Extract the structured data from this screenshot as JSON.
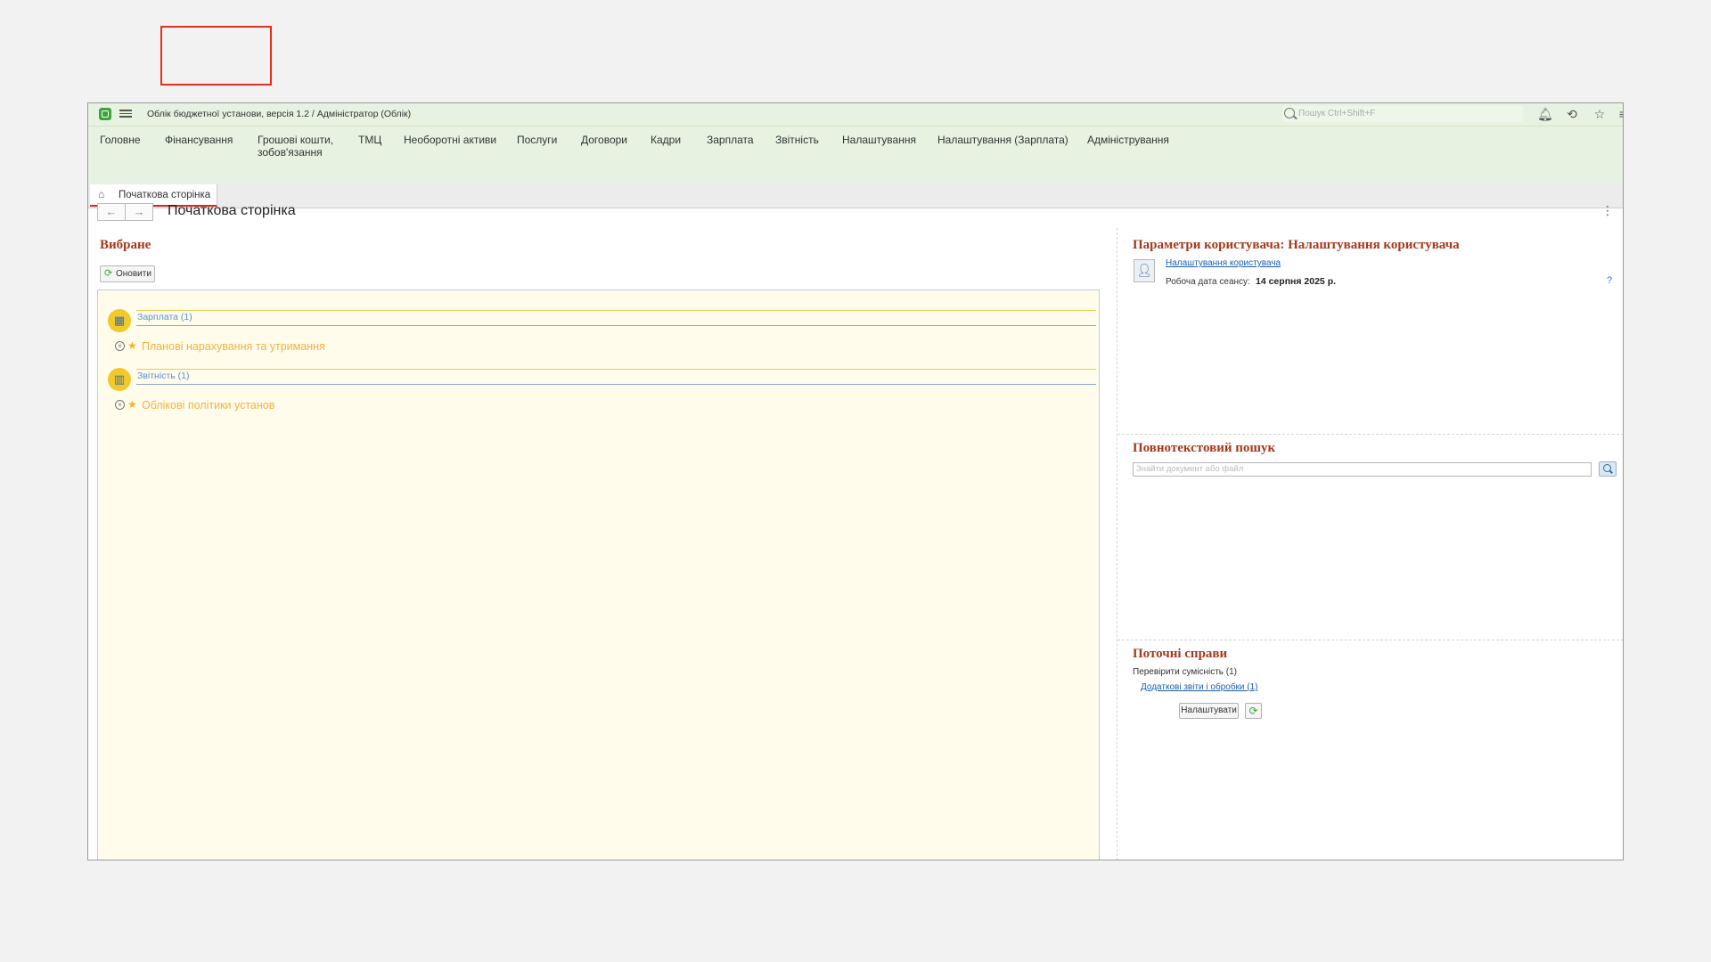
{
  "titlebar": {
    "app_title": "Облік бюджетної установи, версія 1.2 / Адміністратор  (Облік)",
    "search_placeholder": "Пошук Ctrl+Shift+F"
  },
  "sections": [
    {
      "label": "Головне"
    },
    {
      "label": "Фінансування"
    },
    {
      "label": "Грошові кошти, зобов'язання"
    },
    {
      "label": "ТМЦ"
    },
    {
      "label": "Необоротні активи"
    },
    {
      "label": "Послуги"
    },
    {
      "label": "Договори"
    },
    {
      "label": "Кадри"
    },
    {
      "label": "Зарплата"
    },
    {
      "label": "Звітність"
    },
    {
      "label": "Налаштування"
    },
    {
      "label": "Налаштування (Зарплата)"
    },
    {
      "label": "Адміністрування"
    }
  ],
  "tab": {
    "label": "Початкова сторінка"
  },
  "page": {
    "title": "Початкова сторінка"
  },
  "favorites": {
    "heading": "Вибране",
    "refresh_label": "Оновити",
    "groups": [
      {
        "label": "Зарплата (1)",
        "item": "Планові нарахування та утримання"
      },
      {
        "label": "Звітність (1)",
        "item": "Облікові політики установ"
      }
    ]
  },
  "user_params": {
    "heading": "Параметри користувача: Налаштування користувача",
    "settings_link": "Налаштування користувача",
    "work_date_label": "Робоча дата сеансу:",
    "work_date_value": "14 серпня 2025 р.",
    "help": "?"
  },
  "fulltext": {
    "heading": "Повнотекстовий пошук",
    "placeholder": "Знайти документ або файл"
  },
  "current_tasks": {
    "heading": "Поточні справи",
    "check_text": "Перевірити сумісність (1)",
    "reports_link": "Додаткові звіти і обробки (1)",
    "configure_label": "Налаштувати"
  },
  "colors": {
    "accent_green": "#e7f2e0",
    "heading_red": "#a33a1d",
    "highlight": "#e0311e"
  }
}
